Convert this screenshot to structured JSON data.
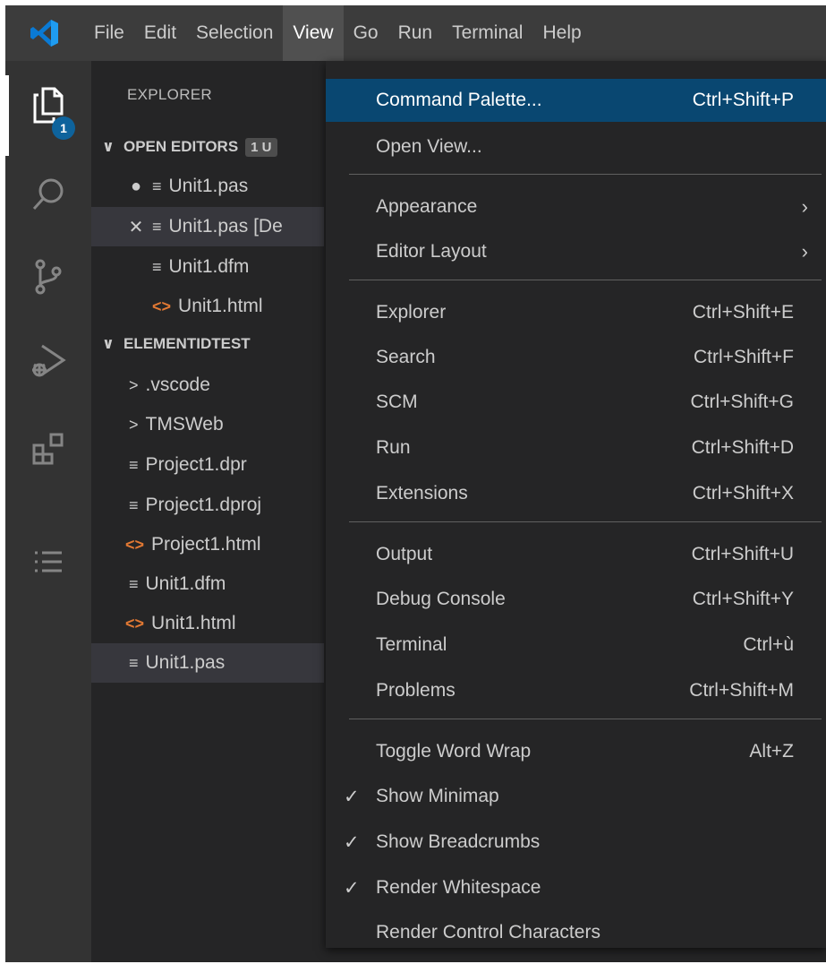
{
  "menubar": {
    "items": [
      "File",
      "Edit",
      "Selection",
      "View",
      "Go",
      "Run",
      "Terminal",
      "Help"
    ],
    "active": "View"
  },
  "activitybar": {
    "icons": [
      "files-icon",
      "search-icon",
      "source-control-icon",
      "run-debug-icon",
      "extensions-icon",
      "list-icon"
    ],
    "badge": "1"
  },
  "sidebar": {
    "title": "EXPLORER",
    "open_editors": {
      "label": "OPEN EDITORS",
      "count": "1 U",
      "items": [
        {
          "lead": "●",
          "icon": "≡",
          "label": "Unit1.pas"
        },
        {
          "lead": "✕",
          "icon": "≡",
          "label": "Unit1.pas [De"
        },
        {
          "lead": "",
          "icon": "≡",
          "label": "Unit1.dfm"
        },
        {
          "lead": "",
          "icon": "<>",
          "label": "Unit1.html"
        }
      ]
    },
    "project": {
      "label": "ELEMENTIDTEST",
      "items": [
        {
          "icon": ">",
          "label": ".vscode"
        },
        {
          "icon": ">",
          "label": "TMSWeb"
        },
        {
          "icon": "≡",
          "label": "Project1.dpr"
        },
        {
          "icon": "≡",
          "label": "Project1.dproj"
        },
        {
          "icon": "<>",
          "label": "Project1.html"
        },
        {
          "icon": "≡",
          "label": "Unit1.dfm"
        },
        {
          "icon": "<>",
          "label": "Unit1.html"
        },
        {
          "icon": "≡",
          "label": "Unit1.pas"
        }
      ]
    }
  },
  "view_menu": {
    "groups": [
      [
        {
          "label": "Command Palette...",
          "shortcut": "Ctrl+Shift+P"
        },
        {
          "label": "Open View...",
          "shortcut": ""
        }
      ],
      [
        {
          "label": "Appearance",
          "submenu": true
        },
        {
          "label": "Editor Layout",
          "submenu": true
        }
      ],
      [
        {
          "label": "Explorer",
          "shortcut": "Ctrl+Shift+E"
        },
        {
          "label": "Search",
          "shortcut": "Ctrl+Shift+F"
        },
        {
          "label": "SCM",
          "shortcut": "Ctrl+Shift+G"
        },
        {
          "label": "Run",
          "shortcut": "Ctrl+Shift+D"
        },
        {
          "label": "Extensions",
          "shortcut": "Ctrl+Shift+X"
        }
      ],
      [
        {
          "label": "Output",
          "shortcut": "Ctrl+Shift+U"
        },
        {
          "label": "Debug Console",
          "shortcut": "Ctrl+Shift+Y"
        },
        {
          "label": "Terminal",
          "shortcut": "Ctrl+ù"
        },
        {
          "label": "Problems",
          "shortcut": "Ctrl+Shift+M"
        }
      ],
      [
        {
          "label": "Toggle Word Wrap",
          "shortcut": "Alt+Z"
        },
        {
          "label": "Show Minimap",
          "checked": true
        },
        {
          "label": "Show Breadcrumbs",
          "checked": true
        },
        {
          "label": "Render Whitespace",
          "checked": true
        },
        {
          "label": "Render Control Characters"
        }
      ]
    ],
    "check_glyph": "✓",
    "submenu_glyph": "›"
  },
  "colors": {
    "highlight": "#094771",
    "html_icon": "#e37933",
    "badge": "#0e639c"
  }
}
